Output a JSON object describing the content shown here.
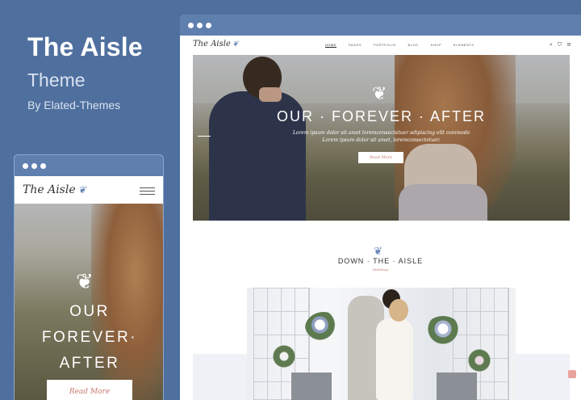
{
  "promo": {
    "title": "The Aisle",
    "subtitle": "Theme",
    "author": "By Elated-Themes"
  },
  "desktop": {
    "logo": "The Aisle",
    "menu": [
      "HOME",
      "PAGES",
      "PORTFOLIO",
      "BLOG",
      "SHOP",
      "ELEMENTS"
    ],
    "hero": {
      "heading": "OUR · FOREVER · AFTER",
      "copy_line1": "Lorem ipsum dolor sit amet loremconsectetuer adipiscing elit commodo",
      "copy_line2": "Lorem ipsum dolor sit amet, loremconsectetuer.",
      "button": "Read More"
    },
    "section": {
      "title": "DOWN · THE · AISLE",
      "subtitle": "Weddings"
    }
  },
  "mobile": {
    "logo": "The Aisle",
    "hero": {
      "line1": "OUR",
      "line2": "FOREVER·",
      "line3": "AFTER",
      "button": "Read More"
    }
  },
  "icons": {
    "leaf": "leaf-sprig-icon",
    "search": "search-icon",
    "cart": "cart-icon",
    "menu": "hamburger-menu-icon"
  },
  "colors": {
    "background": "#4f6f9e",
    "chrome": "#5f7faf",
    "accent": "#c77a72",
    "leaf": "#6a88b8"
  }
}
